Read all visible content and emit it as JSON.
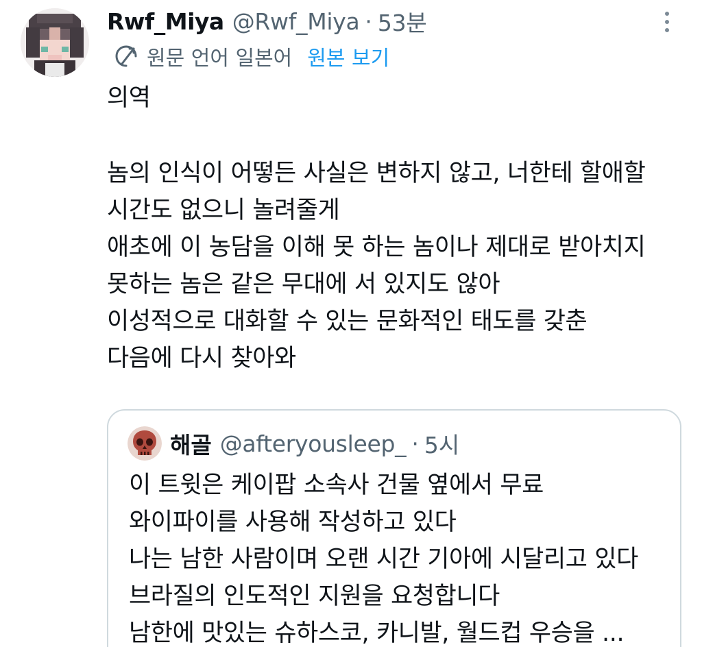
{
  "author": {
    "display_name": "Rwf_Miya",
    "handle": "@Rwf_Miya",
    "separator": "·",
    "time": "53분"
  },
  "translation": {
    "source_language": "원문 언어 일본어",
    "view_original_label": "원본 보기",
    "icon": "translate-icon"
  },
  "body": {
    "heading": "의역",
    "lines": [
      "놈의 인식이 어떻든 사실은 변하지 않고, 너한테 할애할",
      "시간도 없으니 놀려줄게",
      "애초에 이 농담을 이해 못 하는 놈이나 제대로 받아치지",
      "못하는 놈은 같은 무대에 서 있지도 않아",
      "이성적으로 대화할 수 있는 문화적인 태도를 갖춘",
      "다음에 다시 찾아와"
    ]
  },
  "quoted": {
    "display_name": "해골",
    "handle": "@afteryousleep_",
    "separator": "·",
    "time": "5시",
    "avatar_icon": "skull-icon",
    "lines": [
      "이 트윗은 케이팝 소속사 건물 옆에서 무료",
      "와이파이를 사용해 작성하고 있다",
      "나는 남한 사람이며 오랜 시간 기아에 시달리고 있다",
      "브라질의 인도적인 지원을 요청합니다",
      "남한에 맛있는 슈하스코, 카니발, 월드컵 우승을 ..."
    ]
  },
  "colors": {
    "text_primary": "#0f1419",
    "text_secondary": "#536471",
    "link": "#1d9bf0",
    "border": "#cfd9de"
  }
}
